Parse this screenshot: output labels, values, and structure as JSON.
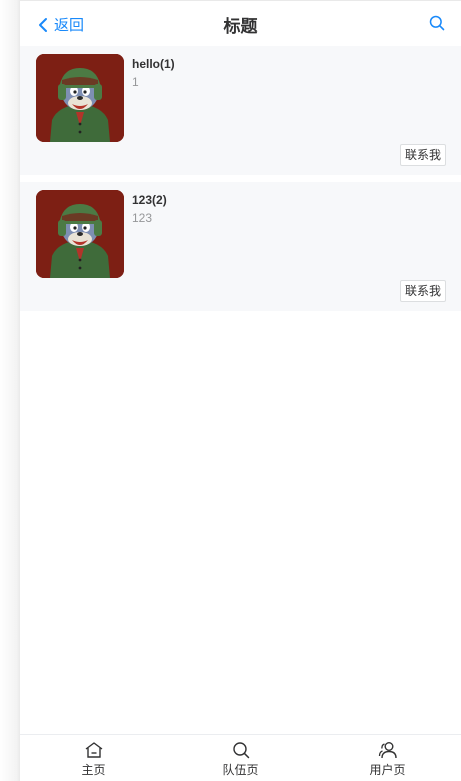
{
  "navbar": {
    "back_label": "返回",
    "title": "标题"
  },
  "teams": [
    {
      "name": "hello(1)",
      "description": "1",
      "contact_label": "联系我"
    },
    {
      "name": "123(2)",
      "description": "123",
      "contact_label": "联系我"
    }
  ],
  "tabbar": {
    "items": [
      {
        "label": "主页",
        "icon": "home-icon"
      },
      {
        "label": "队伍页",
        "icon": "search-icon"
      },
      {
        "label": "用户页",
        "icon": "friends-icon"
      }
    ]
  },
  "colors": {
    "accent": "#1989fa",
    "card_bg": "#f7f8fa",
    "thumb_bg": "#7d1f14"
  }
}
